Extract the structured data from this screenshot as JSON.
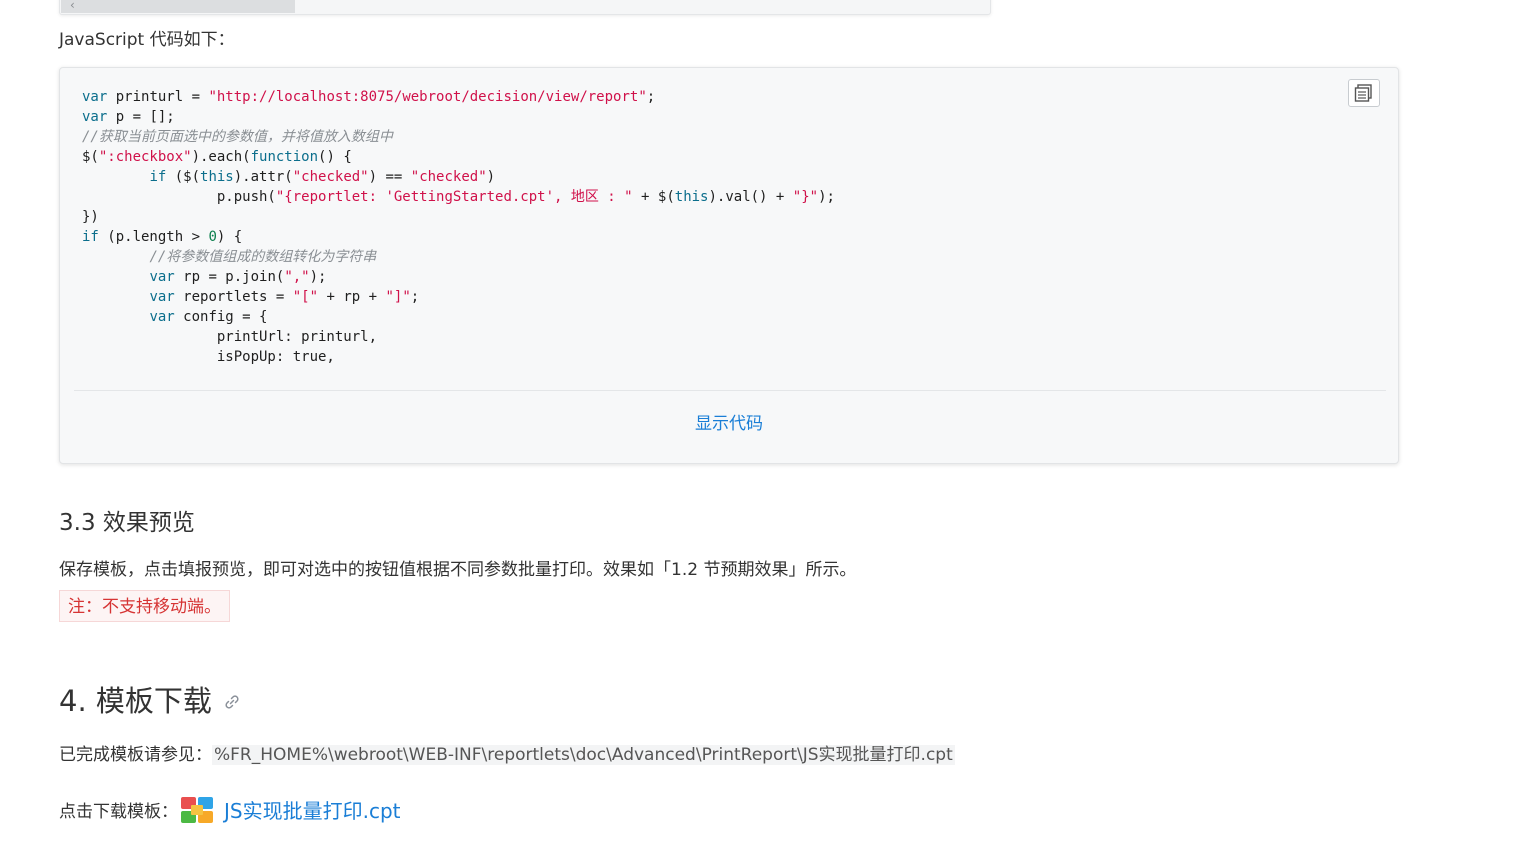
{
  "top_frame": {
    "scroll_glyph": "‹"
  },
  "intro": "JavaScript 代码如下：",
  "code": {
    "lines": [
      [
        {
          "t": "var",
          "c": "kw"
        },
        {
          "t": " printurl = "
        },
        {
          "t": "\"http://localhost:8075/webroot/decision/view/report\"",
          "c": "str"
        },
        {
          "t": ";"
        }
      ],
      [
        {
          "t": "var",
          "c": "kw"
        },
        {
          "t": " p = [];"
        }
      ],
      [
        {
          "t": "//获取当前页面选中的参数值，并将值放入数组中",
          "c": "cmt"
        }
      ],
      [
        {
          "t": "$("
        },
        {
          "t": "\":checkbox\"",
          "c": "str"
        },
        {
          "t": ").each("
        },
        {
          "t": "function",
          "c": "kw"
        },
        {
          "t": "() {"
        }
      ],
      [
        {
          "t": "        "
        },
        {
          "t": "if",
          "c": "kw"
        },
        {
          "t": " ($("
        },
        {
          "t": "this",
          "c": "kw"
        },
        {
          "t": ").attr("
        },
        {
          "t": "\"checked\"",
          "c": "str"
        },
        {
          "t": ") == "
        },
        {
          "t": "\"checked\"",
          "c": "str"
        },
        {
          "t": ")"
        }
      ],
      [
        {
          "t": "                p.push("
        },
        {
          "t": "\"{reportlet: 'GettingStarted.cpt', 地区 : \"",
          "c": "str"
        },
        {
          "t": " + $("
        },
        {
          "t": "this",
          "c": "kw"
        },
        {
          "t": ").val() + "
        },
        {
          "t": "\"}\"",
          "c": "str"
        },
        {
          "t": ");"
        }
      ],
      [
        {
          "t": "})"
        }
      ],
      [
        {
          "t": "if",
          "c": "kw"
        },
        {
          "t": " (p.length > "
        },
        {
          "t": "0",
          "c": "num"
        },
        {
          "t": ") {"
        }
      ],
      [
        {
          "t": "        "
        },
        {
          "t": "//将参数值组成的数组转化为字符串",
          "c": "cmt"
        }
      ],
      [
        {
          "t": "        "
        },
        {
          "t": "var",
          "c": "kw"
        },
        {
          "t": " rp = p.join("
        },
        {
          "t": "\",\"",
          "c": "str"
        },
        {
          "t": ");"
        }
      ],
      [
        {
          "t": "        "
        },
        {
          "t": "var",
          "c": "kw"
        },
        {
          "t": " reportlets = "
        },
        {
          "t": "\"[\"",
          "c": "str"
        },
        {
          "t": " + rp + "
        },
        {
          "t": "\"]\"",
          "c": "str"
        },
        {
          "t": ";"
        }
      ],
      [
        {
          "t": "        "
        },
        {
          "t": "var",
          "c": "kw"
        },
        {
          "t": " config = {"
        }
      ],
      [
        {
          "t": "                printUrl: printurl,"
        }
      ],
      [
        {
          "t": "                isPopUp: true,"
        }
      ]
    ],
    "copy_icon": "copy-icon",
    "show_code_label": "显示代码"
  },
  "section_3_3": {
    "title": "3.3 效果预览",
    "body": "保存模板，点击填报预览，即可对选中的按钮值根据不同参数批量打印。效果如「1.2 节预期效果」所示。",
    "note": "注：不支持移动端。"
  },
  "section_4": {
    "title": "4. 模板下载",
    "anchor_icon": "link-icon",
    "path_prefix": "已完成模板请参见：",
    "path": "%FR_HOME%\\webroot\\WEB-INF\\reportlets\\doc\\Advanced\\PrintReport\\JS实现批量打印.cpt",
    "download_prefix": "点击下载模板：",
    "download_icon": "file-icon",
    "download_link": "JS实现批量打印.cpt"
  }
}
